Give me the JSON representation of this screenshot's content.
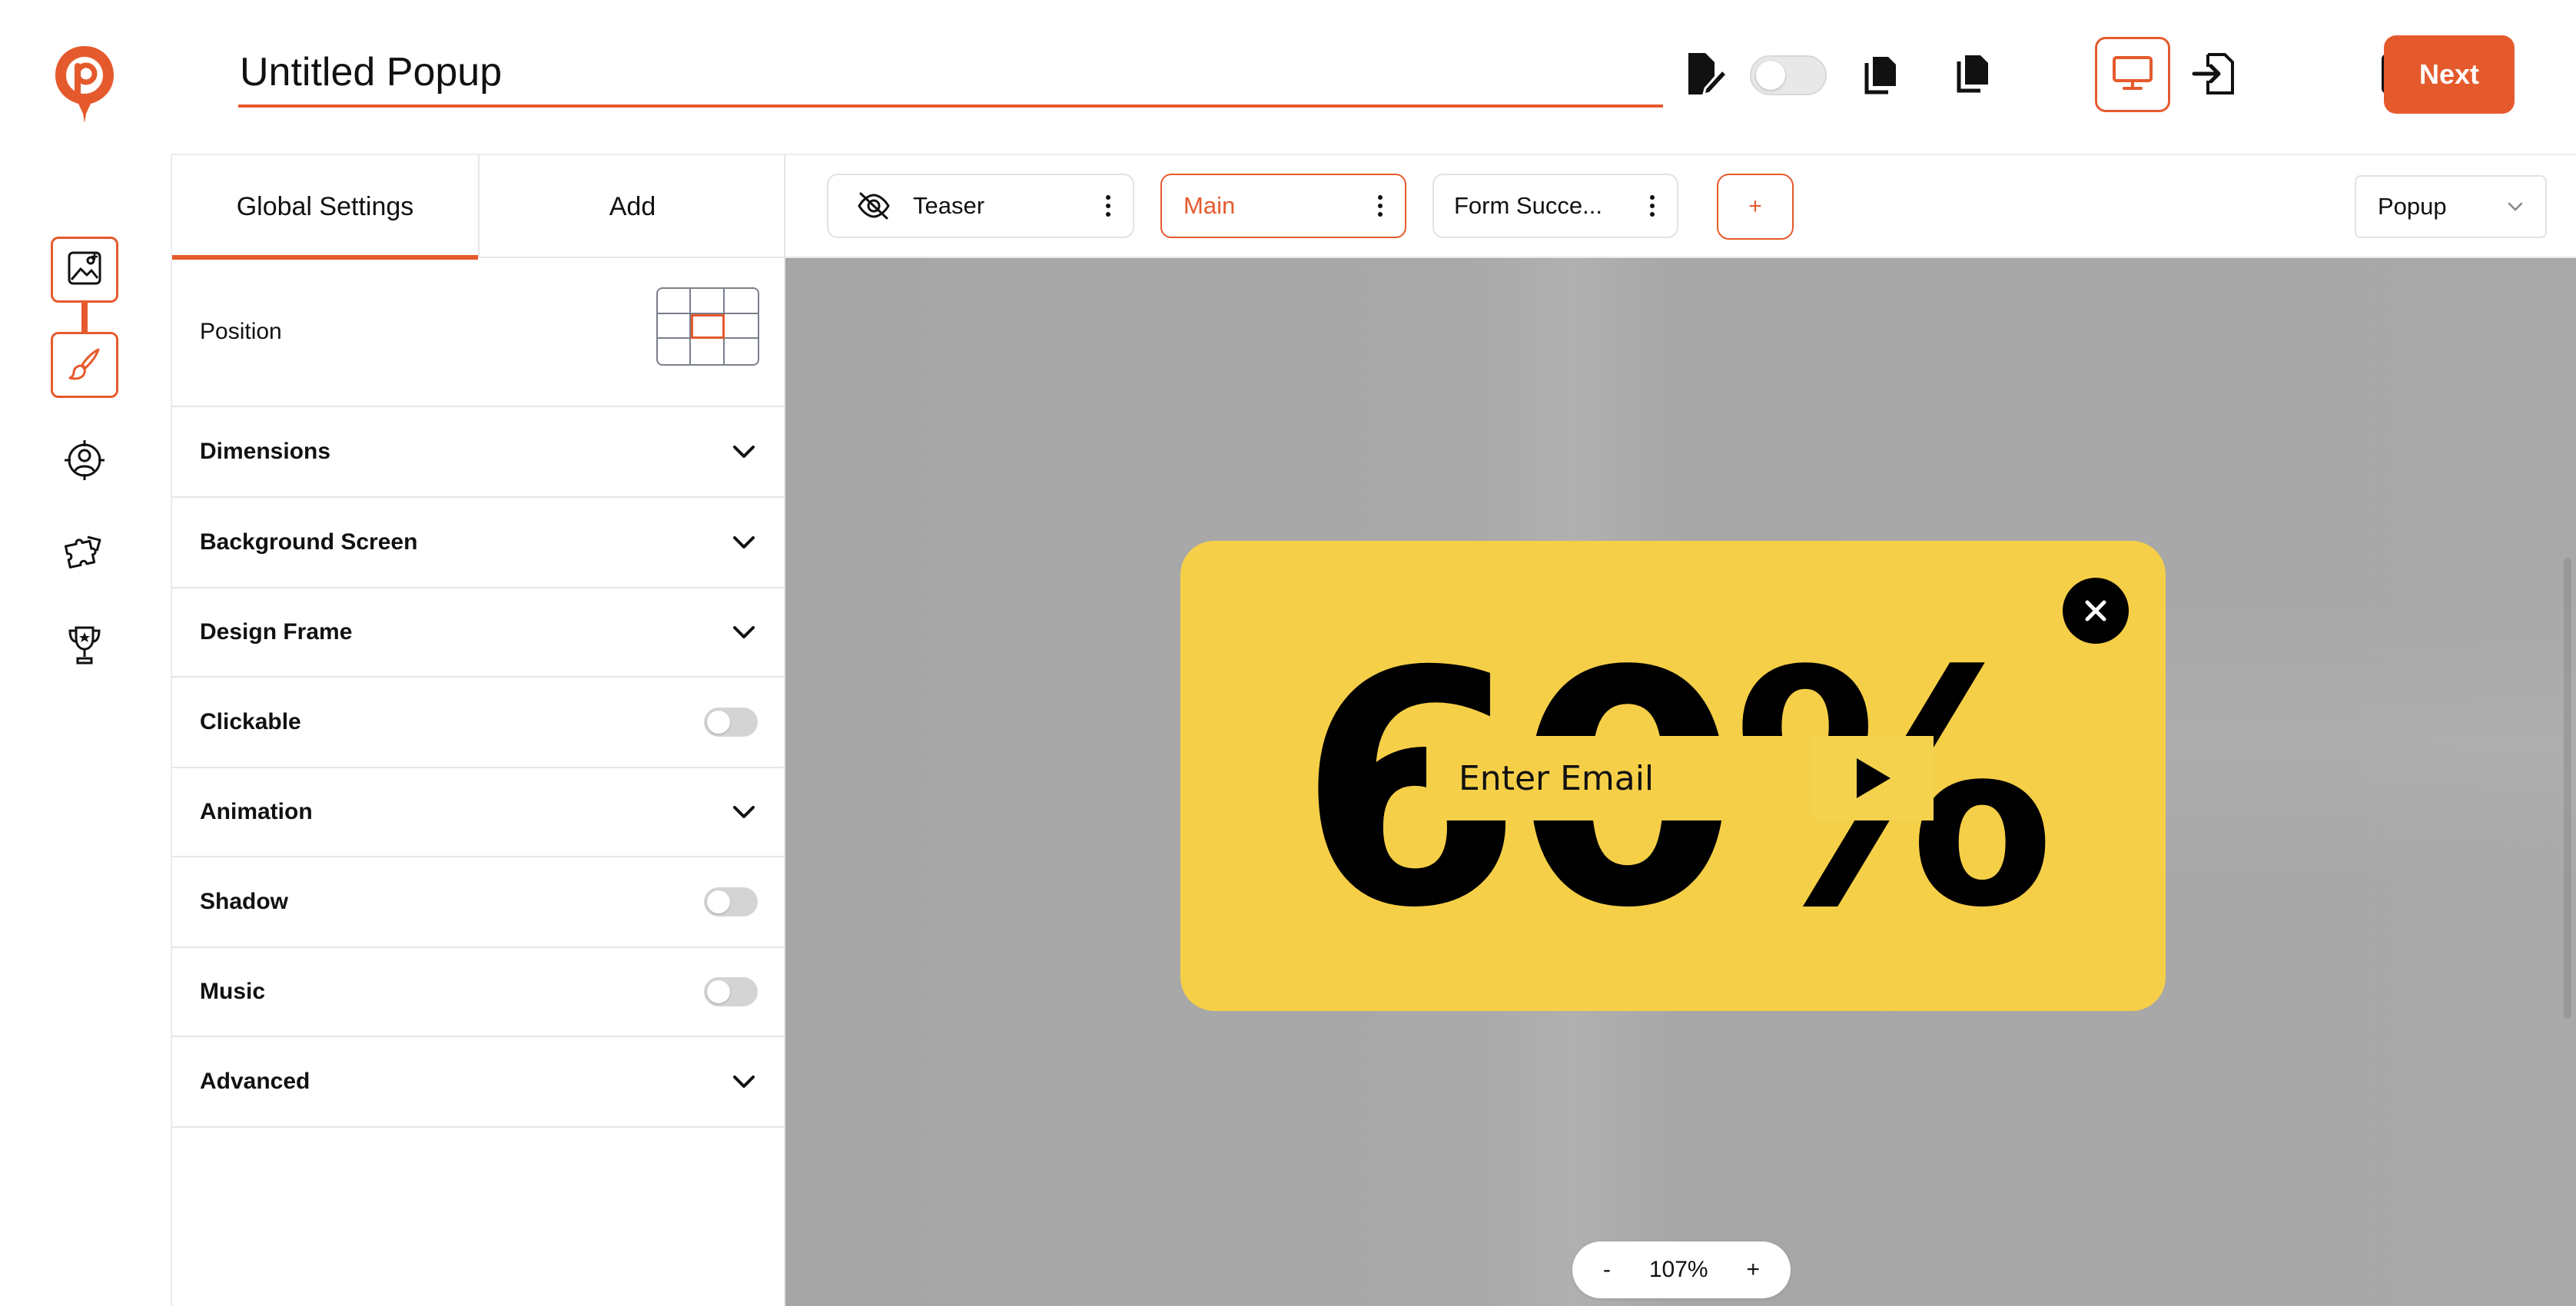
{
  "app": {
    "title": "Untitled Popup",
    "accent": "#e55a2d",
    "popup_color": "#f6cf48"
  },
  "rail": {
    "icons": [
      "image-icon",
      "brush-icon",
      "target-user-icon",
      "puzzle-icon",
      "trophy-icon"
    ]
  },
  "toolbar": {
    "next_label": "Next",
    "icons": [
      "edit-document-icon",
      "toggle",
      "copy-icon",
      "duplicate-icon",
      "export-icon",
      "desktop-icon",
      "mobile-icon",
      "open-external-icon"
    ]
  },
  "panel": {
    "tabs": [
      {
        "label": "Global Settings",
        "active": true
      },
      {
        "label": "Add",
        "active": false
      }
    ],
    "position_label": "Position",
    "rows": [
      {
        "label": "Dimensions",
        "control": "chevron"
      },
      {
        "label": "Background Screen",
        "control": "chevron"
      },
      {
        "label": "Design Frame",
        "control": "chevron"
      },
      {
        "label": "Clickable",
        "control": "toggle"
      },
      {
        "label": "Animation",
        "control": "chevron"
      },
      {
        "label": "Shadow",
        "control": "toggle"
      },
      {
        "label": "Music",
        "control": "toggle"
      },
      {
        "label": "Advanced",
        "control": "chevron"
      }
    ]
  },
  "steps": {
    "items": [
      {
        "label": "Teaser",
        "hidden": true,
        "active": false
      },
      {
        "label": "Main",
        "hidden": false,
        "active": true
      },
      {
        "label": "Form Succe...",
        "hidden": false,
        "active": false
      }
    ],
    "add_label": "+",
    "view_select": "Popup"
  },
  "popup": {
    "headline": "60%",
    "email_placeholder": "Enter Email"
  },
  "zoom": {
    "minus": "-",
    "value": "107%",
    "plus": "+"
  }
}
